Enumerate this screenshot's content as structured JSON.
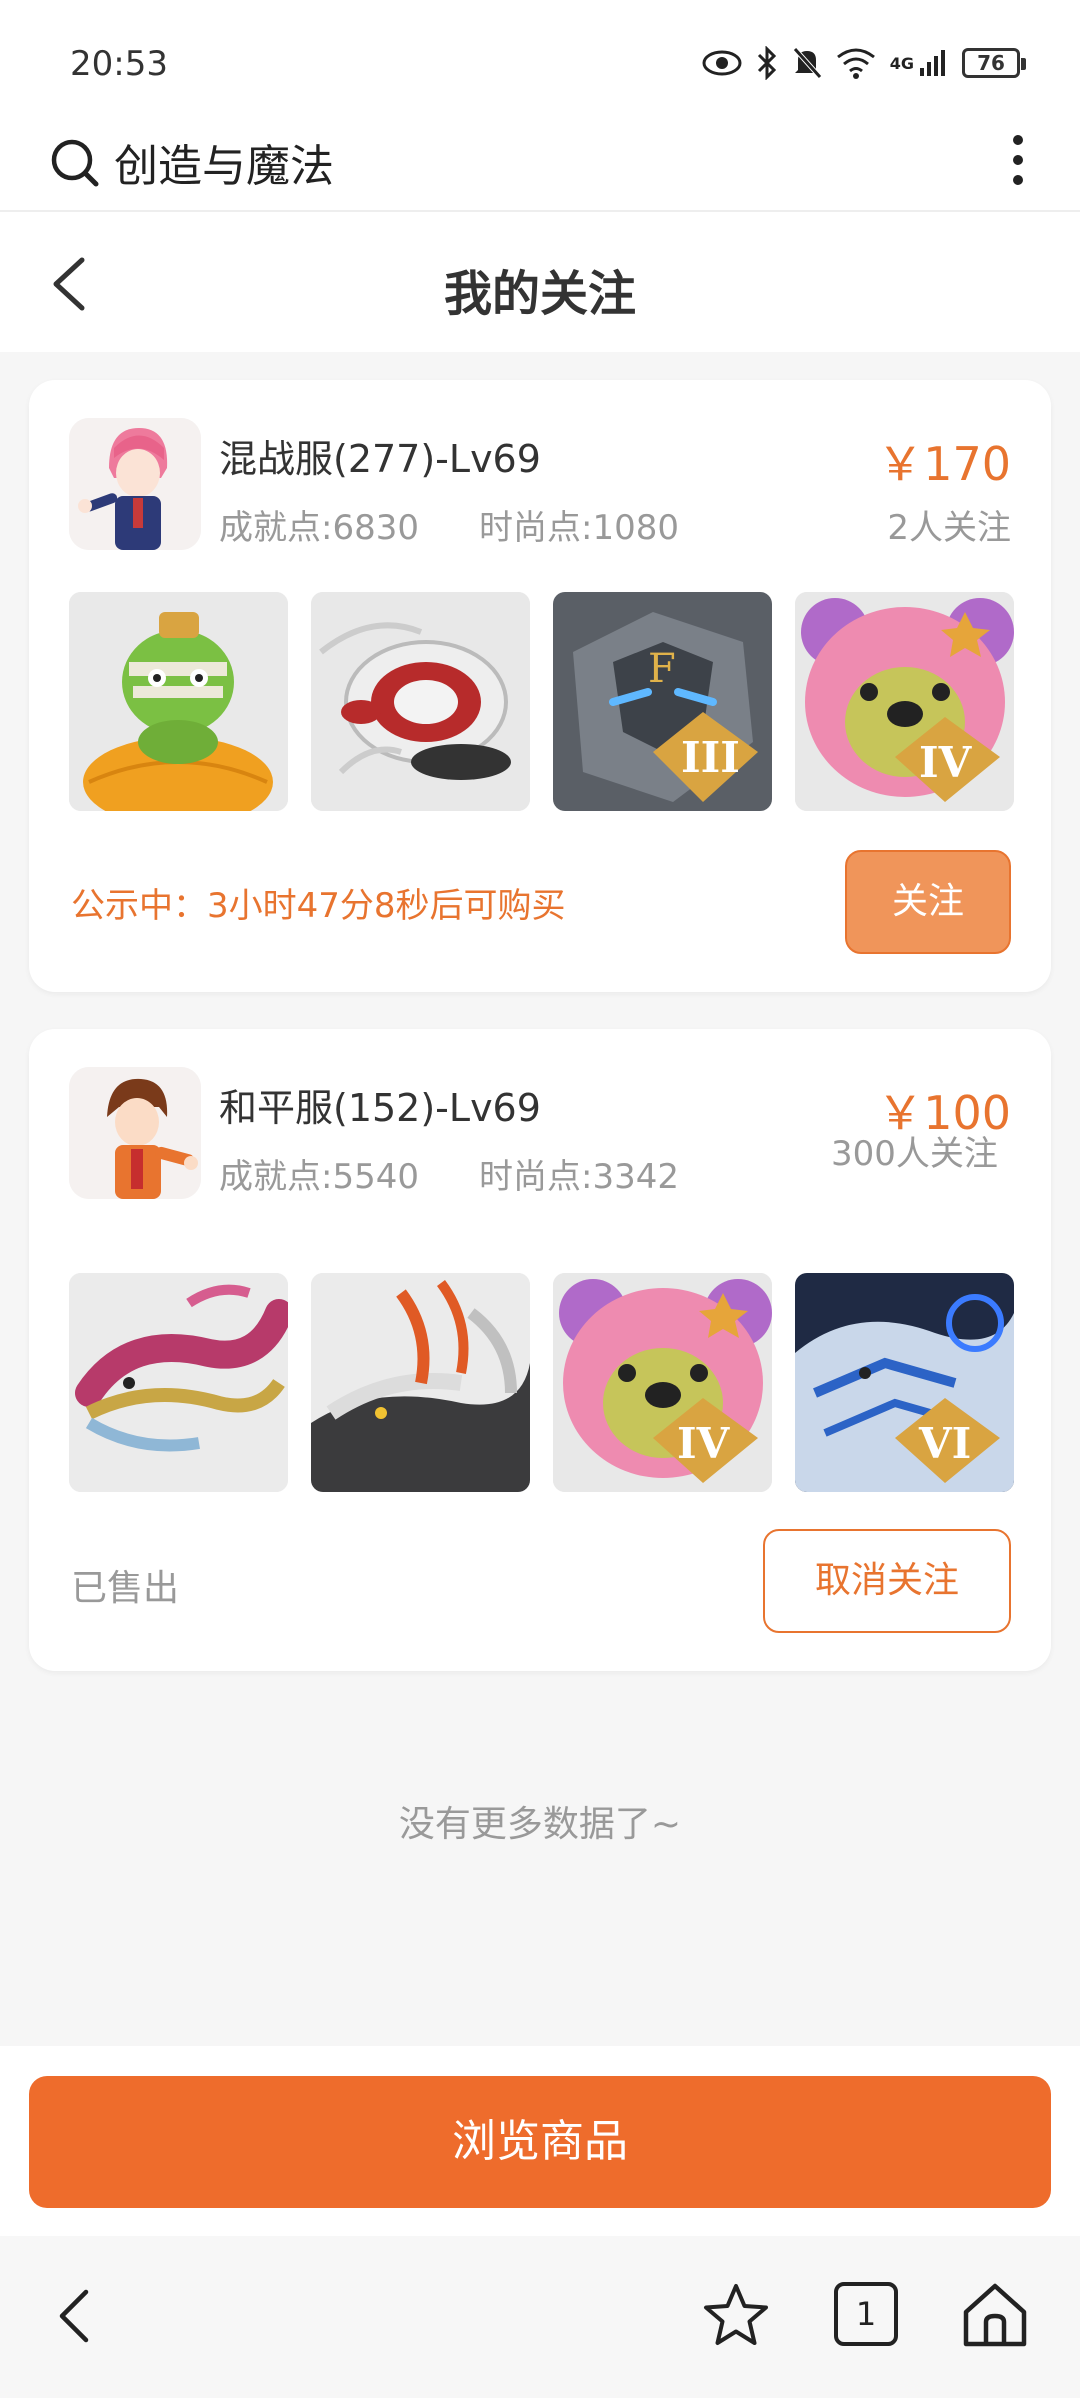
{
  "status_bar": {
    "time": "20:53",
    "network": "4G",
    "battery": "76"
  },
  "browser": {
    "search_query": "创造与魔法",
    "tab_count": "1"
  },
  "header": {
    "title": "我的关注"
  },
  "listings": [
    {
      "server": "混战服(277)-Lv69",
      "achievement": "成就点:6830",
      "fashion": "时尚点:1080",
      "price": "￥170",
      "followers": "2人关注",
      "status_text": "公示中：3小时47分8秒后可购买",
      "action_label": "关注",
      "badges": [
        "",
        "",
        "III",
        "IV"
      ]
    },
    {
      "server": "和平服(152)-Lv69",
      "achievement": "成就点:5540",
      "fashion": "时尚点:3342",
      "price": "￥100",
      "followers": "300人关注",
      "status_text": "已售出",
      "action_label": "取消关注",
      "badges": [
        "",
        "",
        "IV",
        "VI"
      ]
    }
  ],
  "footer": {
    "no_more": "没有更多数据了~",
    "browse_label": "浏览商品"
  },
  "colors": {
    "accent": "#e8742f",
    "primary_button": "#ee6c2c",
    "follow_button": "#f0955a"
  }
}
